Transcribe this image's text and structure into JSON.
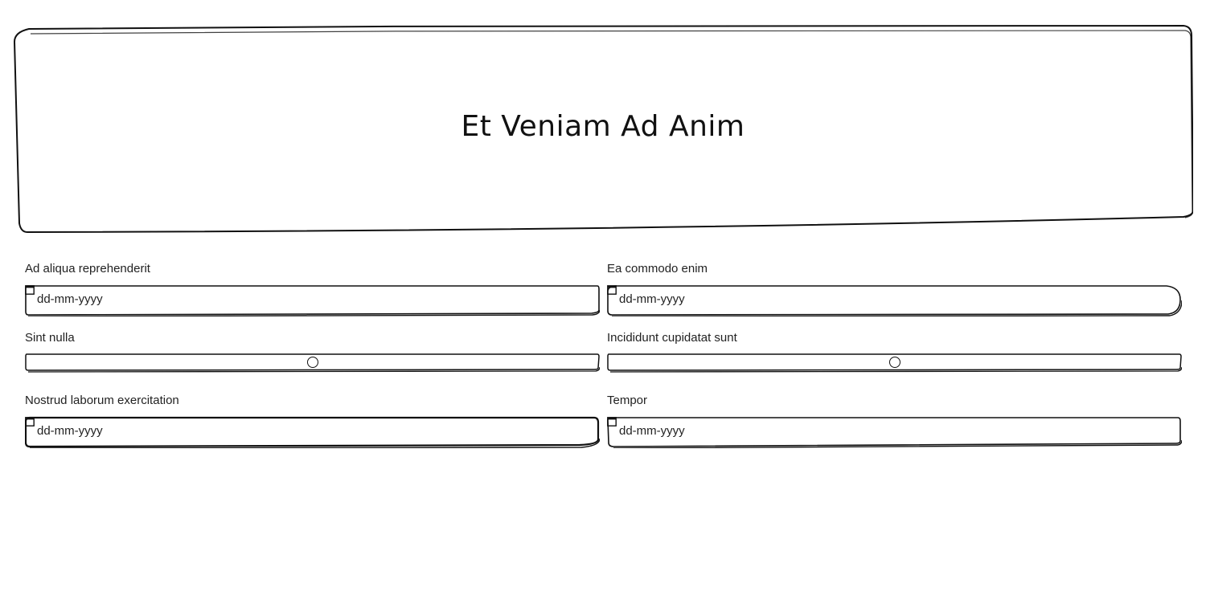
{
  "header": {
    "title": "Et Veniam Ad Anim"
  },
  "fields": {
    "f1": {
      "label": "Ad aliqua reprehenderit",
      "placeholder": "dd-mm-yyyy"
    },
    "f2": {
      "label": "Ea commodo enim",
      "placeholder": "dd-mm-yyyy"
    },
    "f3": {
      "label": "Sint nulla",
      "value": 0.5
    },
    "f4": {
      "label": "Incididunt cupidatat sunt",
      "value": 0.5
    },
    "f5": {
      "label": "Nostrud laborum exercitation",
      "placeholder": "dd-mm-yyyy"
    },
    "f6": {
      "label": "Tempor",
      "placeholder": "dd-mm-yyyy"
    }
  },
  "icons": {
    "date_picker": "calendar-icon",
    "slider_thumb": "slider-thumb"
  },
  "colors": {
    "stroke": "#111111",
    "background": "#ffffff"
  }
}
